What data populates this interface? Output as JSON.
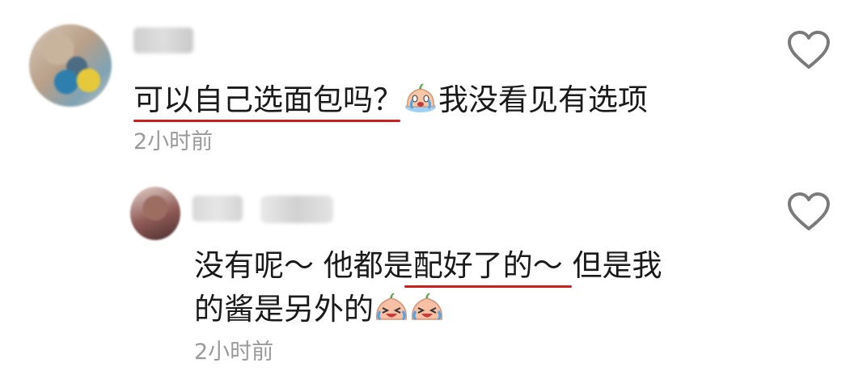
{
  "comment": {
    "text_before_emoji": "可以自己选面包吗？",
    "emoji": "crying-bun-emoji",
    "text_after_emoji": "我没看见有选项",
    "time": "2小时前",
    "like_icon": "heart-outline-icon"
  },
  "reply": {
    "line1": "没有呢～ 他都是配好了的～ 但是我",
    "line2": "的酱是另外的",
    "emojis": [
      "laughing-crying-bun-emoji",
      "laughing-crying-bun-emoji"
    ],
    "time": "2小时前",
    "like_icon": "heart-outline-icon"
  },
  "colors": {
    "underline": "#cc2020",
    "text": "#1a1a1a",
    "time": "#9a9a9a",
    "heart": "#7a7a7a"
  }
}
